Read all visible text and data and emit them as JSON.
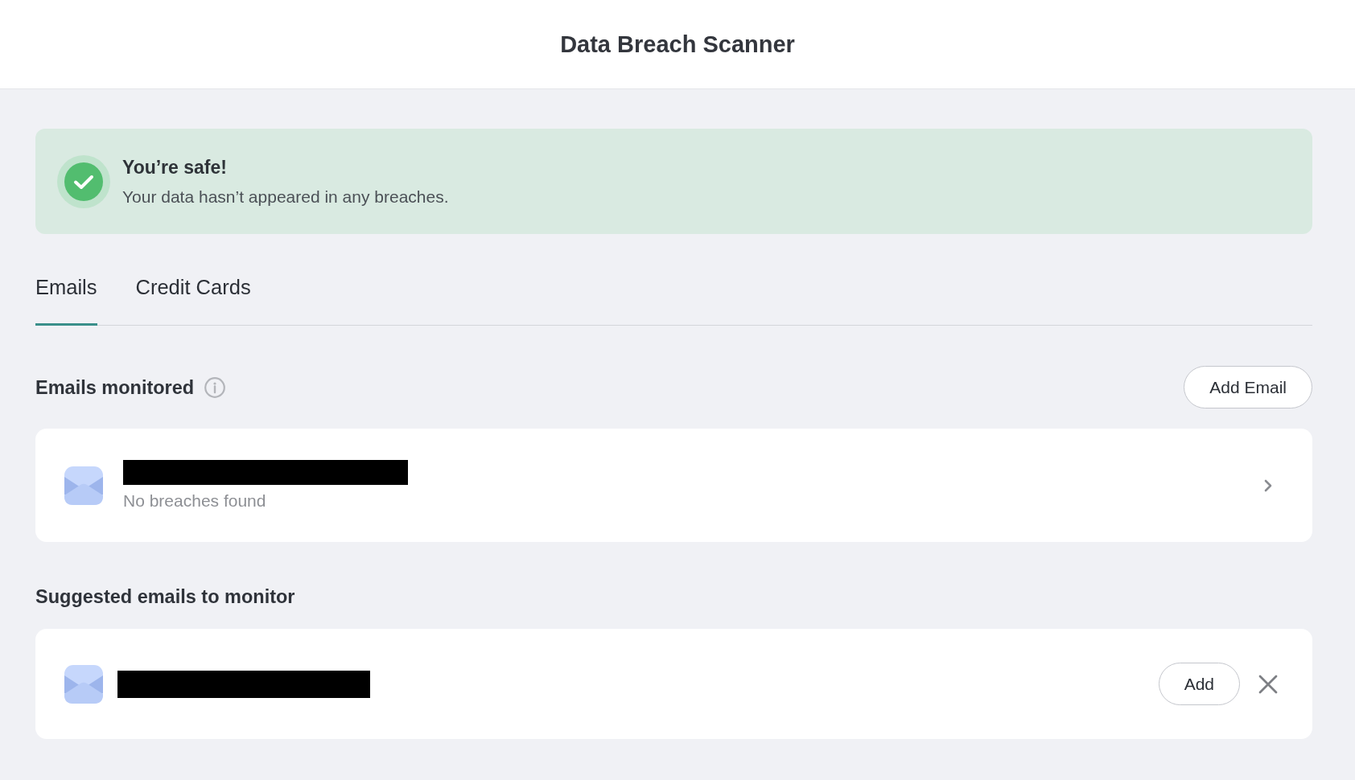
{
  "header": {
    "title": "Data Breach Scanner"
  },
  "status_banner": {
    "title": "You’re safe!",
    "message": "Your data hasn’t appeared in any breaches."
  },
  "tabs": [
    {
      "label": "Emails",
      "selected": true
    },
    {
      "label": "Credit Cards",
      "selected": false
    }
  ],
  "monitored": {
    "heading": "Emails monitored",
    "add_button": "Add Email",
    "emails": [
      {
        "status": "No breaches found"
      }
    ]
  },
  "suggested": {
    "heading": "Suggested emails to monitor",
    "emails": [
      {
        "add_button": "Add"
      }
    ]
  }
}
